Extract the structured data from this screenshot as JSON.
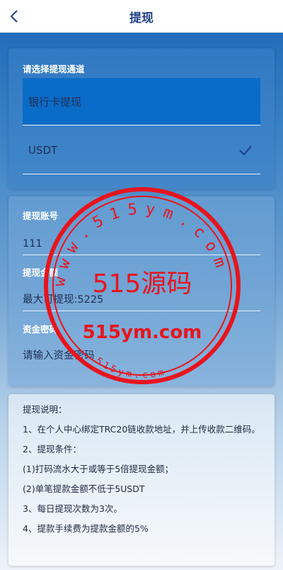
{
  "header": {
    "title": "提现"
  },
  "channel": {
    "label": "请选择提现通道",
    "options": [
      {
        "label": "银行卡提现",
        "selected": true
      },
      {
        "label": "USDT",
        "checked": true
      }
    ]
  },
  "account": {
    "label": "提现账号",
    "value": "111"
  },
  "amount": {
    "label": "提现金额",
    "placeholder": "最大可提现:5225"
  },
  "password": {
    "label": "资金密码",
    "placeholder": "请输入资金密码"
  },
  "notes": {
    "title": "提现说明：",
    "items": [
      "1、在个人中心绑定TRC20链收款地址，并上传收款二维码。",
      "2、提现条件：",
      "(1)打码流水大于或等于5倍提现金额；",
      "(2)单笔提款金额不低于5USDT",
      "3、每日提现次数为3次。",
      "4、提款手续费为提款金额的5%"
    ]
  },
  "watermark": {
    "center": "515源码",
    "domain": "515ym.com",
    "ring_top": "www.515ym.com",
    "ring_bottom": "515ym.com"
  },
  "colors": {
    "header_title": "#1d3f8a",
    "selected_channel": "#0a6cc9",
    "stamp_red": "#e8141c"
  }
}
